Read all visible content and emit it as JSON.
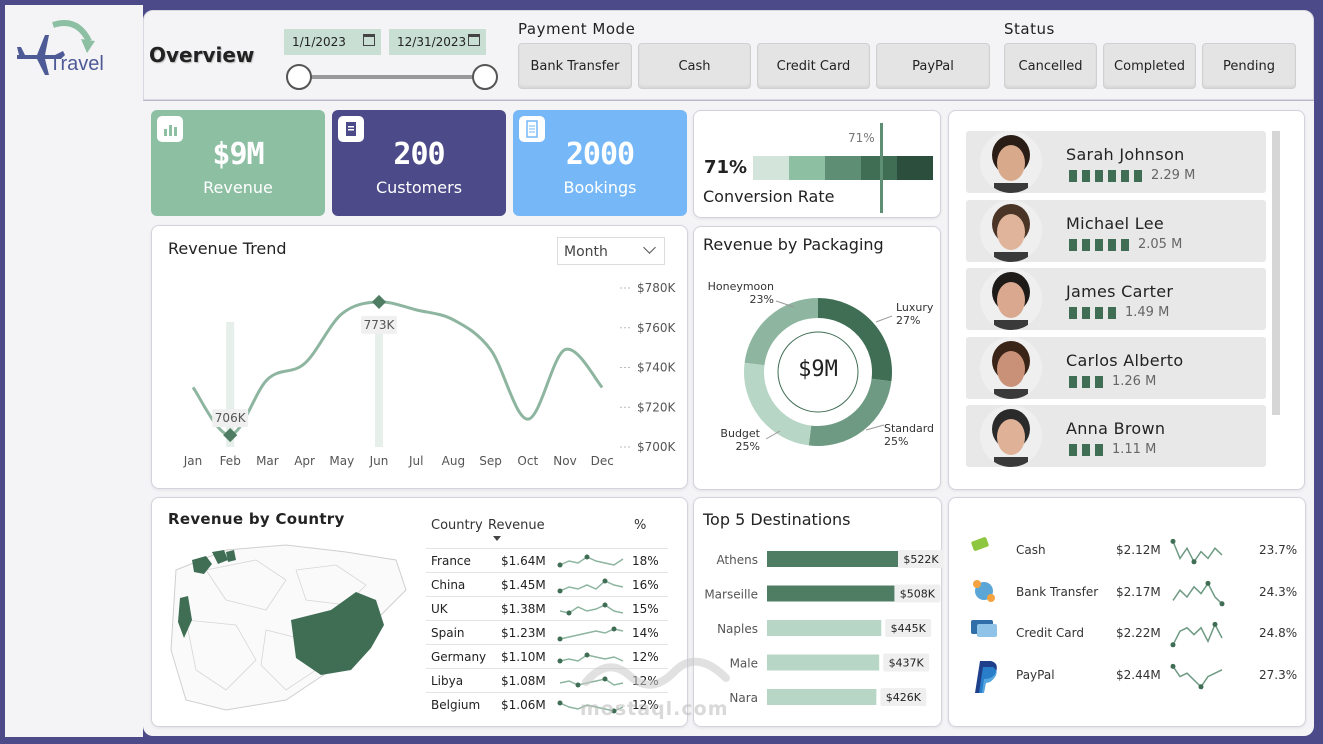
{
  "brand": {
    "logo_text": "Travel"
  },
  "header": {
    "title": "Overview",
    "date_start": "1/1/2023",
    "date_end": "12/31/2023",
    "payment_title": "Payment Mode",
    "payment_modes": [
      "Bank Transfer",
      "Cash",
      "Credit Card",
      "PayPal"
    ],
    "status_title": "Status",
    "statuses": [
      "Cancelled",
      "Completed",
      "Pending"
    ]
  },
  "kpis": {
    "revenue": {
      "value": "$9M",
      "label": "Revenue",
      "color": "#8dbfa3"
    },
    "customers": {
      "value": "200",
      "label": "Customers",
      "color": "#4d4a8a"
    },
    "bookings": {
      "value": "2000",
      "label": "Bookings",
      "color": "#76b8f7"
    }
  },
  "conversion": {
    "value": "71%",
    "marker_label": "71%",
    "label": "Conversion Rate",
    "marker": 0.71
  },
  "customers_list": [
    {
      "name": "Sarah Johnson",
      "score": "2.29 M",
      "bars": 6
    },
    {
      "name": "Michael Lee",
      "score": "2.05 M",
      "bars": 5
    },
    {
      "name": "James Carter",
      "score": "1.49 M",
      "bars": 4
    },
    {
      "name": "Carlos Alberto",
      "score": "1.26 M",
      "bars": 3
    },
    {
      "name": "Anna Brown",
      "score": "1.11 M",
      "bars": 3
    }
  ],
  "revenue_trend": {
    "title": "Revenue Trend",
    "dropdown": "Month",
    "chart_data": {
      "type": "line",
      "categories": [
        "Jan",
        "Feb",
        "Mar",
        "Apr",
        "May",
        "Jun",
        "Jul",
        "Aug",
        "Sep",
        "Oct",
        "Nov",
        "Dec"
      ],
      "values": [
        730,
        706,
        734,
        742,
        767,
        773,
        769,
        764,
        749,
        714,
        749,
        730
      ],
      "ylim": [
        700,
        780
      ],
      "yticks": [
        "$700K",
        "$720K",
        "$740K",
        "$760K",
        "$780K"
      ],
      "annotations": [
        {
          "label": "706K",
          "index": 1
        },
        {
          "label": "773K",
          "index": 5
        }
      ]
    }
  },
  "packaging": {
    "title": "Revenue by Packaging",
    "center": "$9M",
    "chart_data": {
      "type": "pie",
      "slices": [
        {
          "name": "Luxury",
          "pct": "27%",
          "value": 27,
          "color": "#3f6e55"
        },
        {
          "name": "Standard",
          "pct": "25%",
          "value": 25,
          "color": "#6e9a83"
        },
        {
          "name": "Budget",
          "pct": "25%",
          "value": 25,
          "color": "#b8d6c6"
        },
        {
          "name": "Honeymoon",
          "pct": "23%",
          "value": 23,
          "color": "#8db59f"
        }
      ]
    }
  },
  "country": {
    "title": "Revenue by Country",
    "headers": {
      "country": "Country",
      "revenue": "Revenue",
      "pct": "%"
    },
    "rows": [
      {
        "country": "France",
        "revenue": "$1.64M",
        "pct": "18%"
      },
      {
        "country": "China",
        "revenue": "$1.45M",
        "pct": "16%"
      },
      {
        "country": "UK",
        "revenue": "$1.38M",
        "pct": "15%"
      },
      {
        "country": "Spain",
        "revenue": "$1.23M",
        "pct": "14%"
      },
      {
        "country": "Germany",
        "revenue": "$1.10M",
        "pct": "12%"
      },
      {
        "country": "Libya",
        "revenue": "$1.08M",
        "pct": "12%"
      },
      {
        "country": "Belgium",
        "revenue": "$1.06M",
        "pct": "12%"
      }
    ]
  },
  "destinations": {
    "title": "Top 5 Destinations",
    "chart_data": {
      "type": "bar",
      "categories": [
        "Athens",
        "Marseille",
        "Naples",
        "Male",
        "Nara"
      ],
      "values": [
        522,
        508,
        445,
        437,
        426
      ],
      "labels": [
        "$522K",
        "$508K",
        "$445K",
        "$437K",
        "$426K"
      ],
      "xlim": [
        0,
        522
      ]
    }
  },
  "payments": [
    {
      "name": "Cash",
      "value": "$2.12M",
      "pct": "23.7%"
    },
    {
      "name": "Bank Transfer",
      "value": "$2.17M",
      "pct": "24.3%"
    },
    {
      "name": "Credit Card",
      "value": "$2.22M",
      "pct": "24.8%"
    },
    {
      "name": "PayPal",
      "value": "$2.44M",
      "pct": "27.3%"
    }
  ],
  "watermark": {
    "text": "mostaql.com"
  }
}
